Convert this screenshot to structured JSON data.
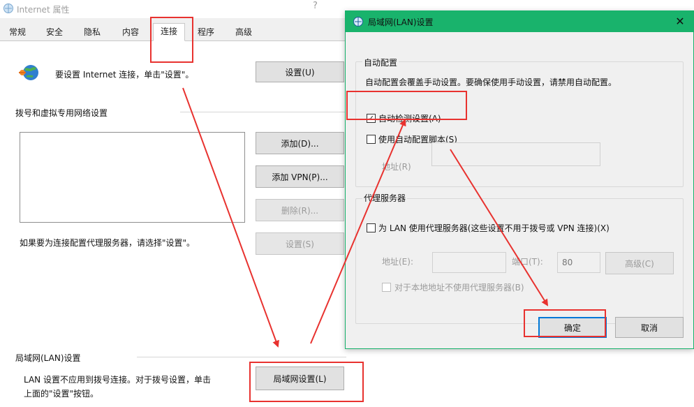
{
  "ie_window": {
    "title": "Internet 属性",
    "help": "?",
    "tabs": [
      "常规",
      "安全",
      "隐私",
      "内容",
      "连接",
      "程序",
      "高级"
    ],
    "active_tab": "连接",
    "setup_text": "要设置 Internet 连接，单击\"设置\"。",
    "setup_button": "设置(U)",
    "dialup_group_label": "拨号和虚拟专用网络设置",
    "add_button": "添加(D)...",
    "add_vpn_button": "添加 VPN(P)...",
    "remove_button": "删除(R)...",
    "settings_button": "设置(S)",
    "proxy_hint": "如果要为连接配置代理服务器，请选择\"设置\"。",
    "lan_group_label": "局域网(LAN)设置",
    "lan_desc_line1": "LAN 设置不应用到拨号连接。对于拨号设置，单击",
    "lan_desc_line2": "上面的\"设置\"按钮。",
    "lan_settings_button": "局域网设置(L)"
  },
  "lan_dialog": {
    "title": "局域网(LAN)设置",
    "close_glyph": "✕",
    "auto_config": {
      "label": "自动配置",
      "description": "自动配置会覆盖手动设置。要确保使用手动设置，请禁用自动配置。",
      "auto_detect_label": "自动检测设置(A)",
      "auto_detect_checked": true,
      "check_glyph": "✓",
      "use_script_label": "使用自动配置脚本(S)",
      "use_script_checked": false,
      "address_label": "地址(R)"
    },
    "proxy": {
      "label": "代理服务器",
      "use_proxy_label": "为 LAN 使用代理服务器(这些设置不用于拨号或 VPN 连接)(X)",
      "use_proxy_checked": false,
      "address_label": "地址(E):",
      "port_label": "端口(T):",
      "port_value": "80",
      "advanced_button": "高级(C)",
      "bypass_label": "对于本地地址不使用代理服务器(B)",
      "bypass_checked": false
    },
    "ok_button": "确定",
    "cancel_button": "取消"
  },
  "colors": {
    "annotation": "#e8322f",
    "dialog_titlebar": "#19b36c",
    "ok_focus": "#0078d7"
  }
}
